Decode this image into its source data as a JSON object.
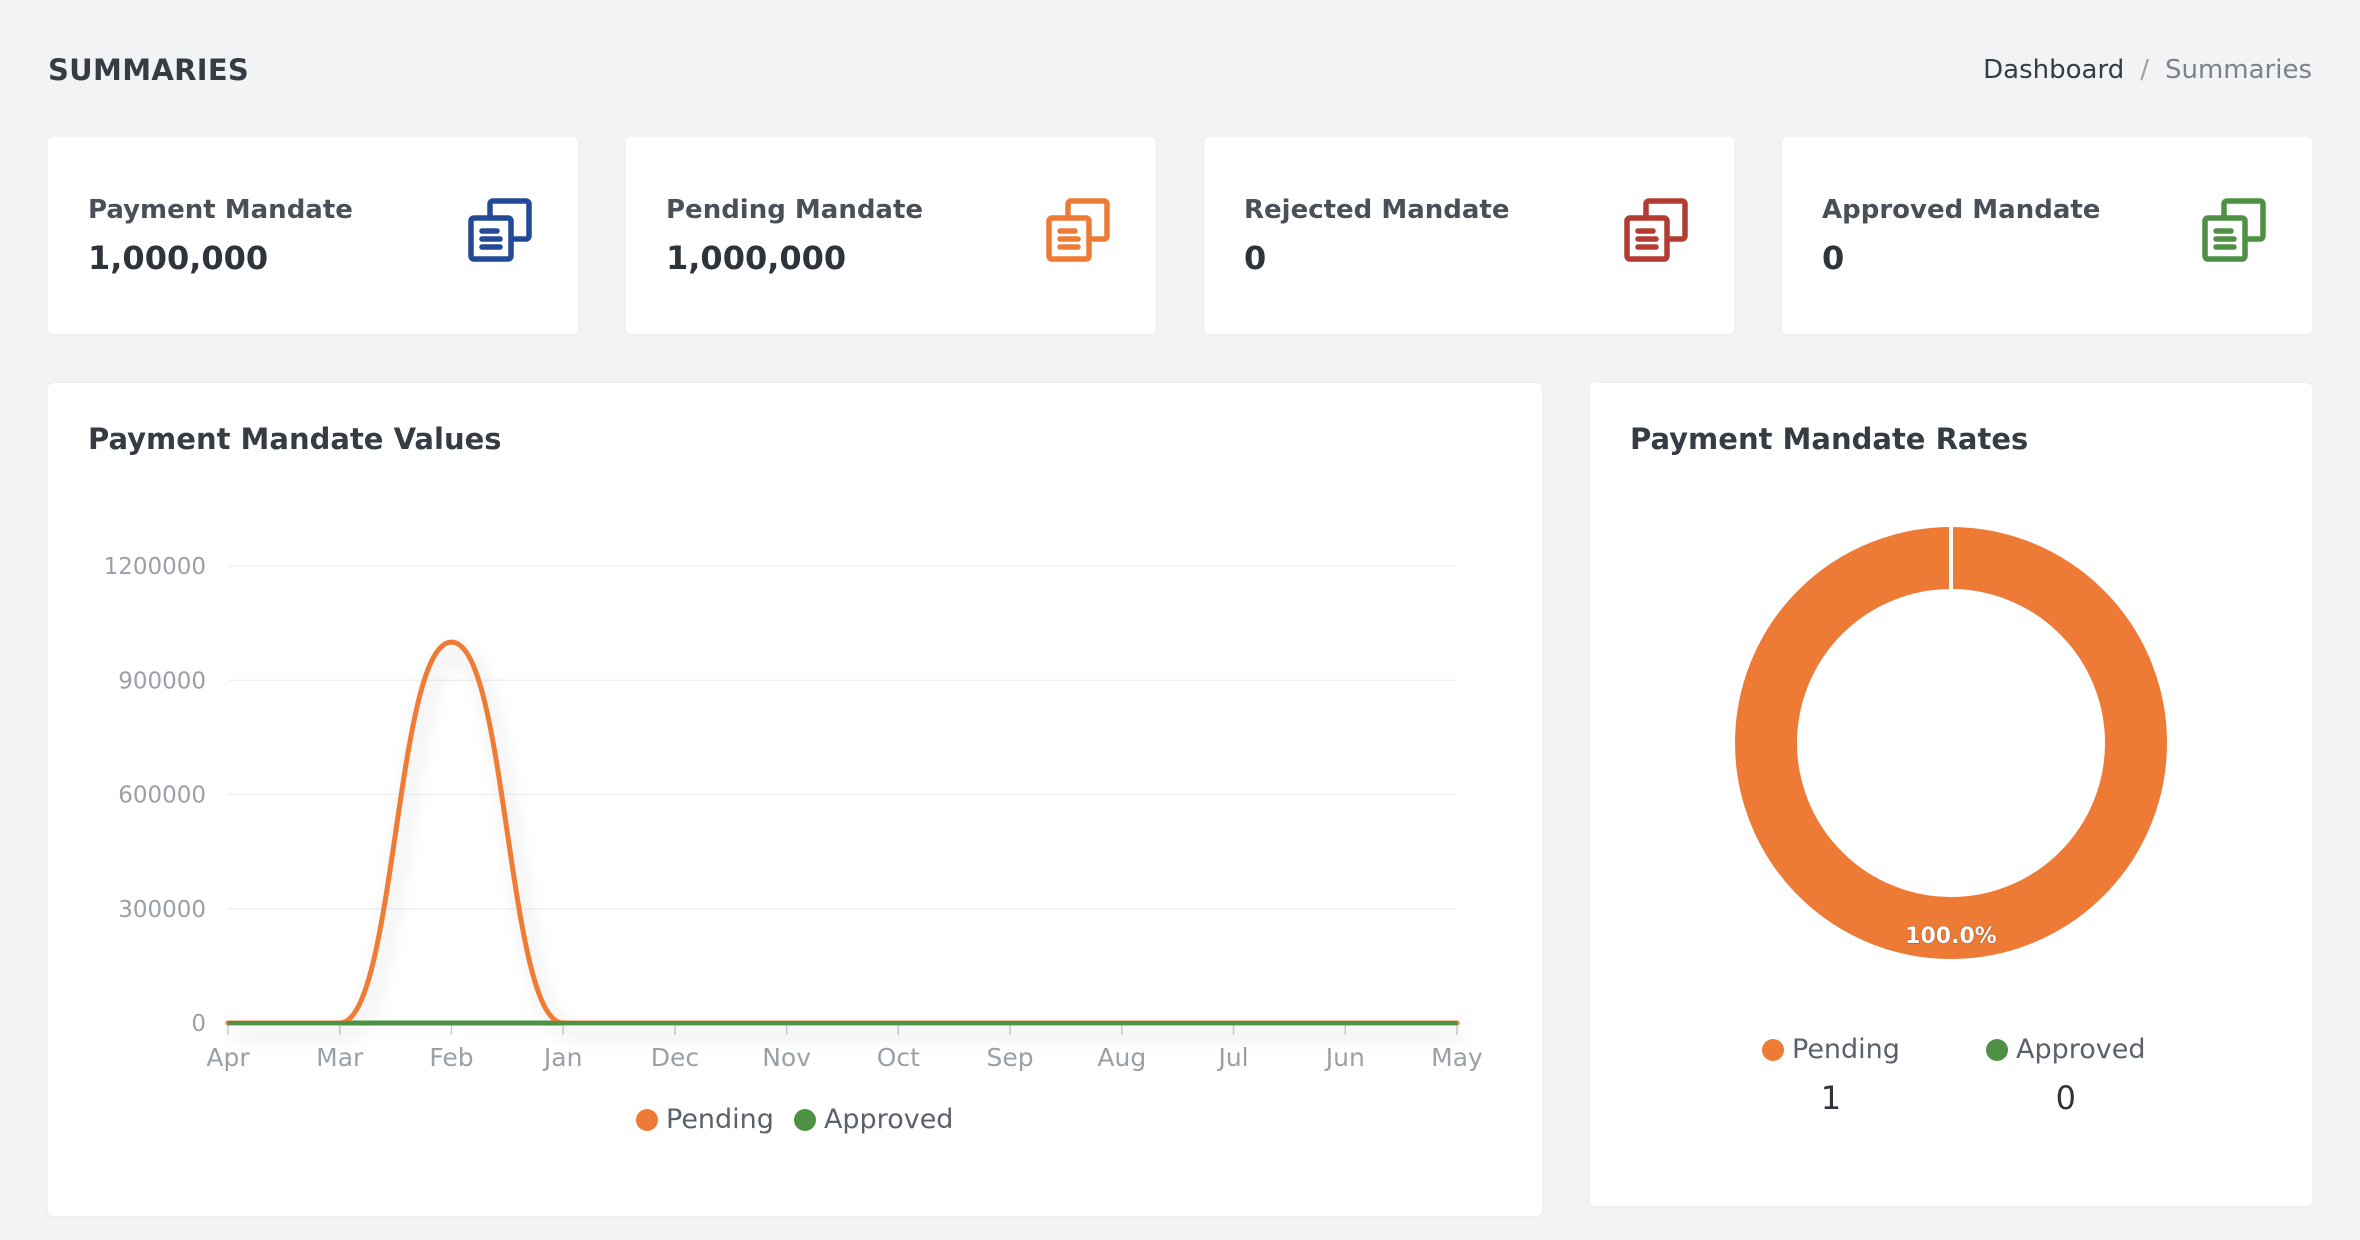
{
  "header": {
    "title": "SUMMARIES",
    "breadcrumb": {
      "home": "Dashboard",
      "separator": "/",
      "current": "Summaries"
    }
  },
  "stats": [
    {
      "label": "Payment Mandate",
      "value": "1,000,000",
      "color": "#234a96",
      "icon": "documents-icon"
    },
    {
      "label": "Pending Mandate",
      "value": "1,000,000",
      "color": "#ee7b35",
      "icon": "documents-icon"
    },
    {
      "label": "Rejected Mandate",
      "value": "0",
      "color": "#b23b32",
      "icon": "documents-icon"
    },
    {
      "label": "Approved Mandate",
      "value": "0",
      "color": "#4f9144",
      "icon": "documents-icon"
    }
  ],
  "values_panel": {
    "title": "Payment Mandate Values"
  },
  "rates_panel": {
    "title": "Payment Mandate Rates",
    "slice_label": "100.0%"
  },
  "colors": {
    "pending": "#ee7b35",
    "approved": "#4f9144",
    "grid": "#eef0f3",
    "tick": "#9aa0a8"
  },
  "chart_data": [
    {
      "type": "area",
      "title": "Payment Mandate Values",
      "categories": [
        "Apr",
        "Mar",
        "Feb",
        "Jan",
        "Dec",
        "Nov",
        "Oct",
        "Sep",
        "Aug",
        "Jul",
        "Jun",
        "May"
      ],
      "series": [
        {
          "name": "Pending",
          "color": "#ee7b35",
          "values": [
            0,
            0,
            1000000,
            0,
            0,
            0,
            0,
            0,
            0,
            0,
            0,
            0
          ]
        },
        {
          "name": "Approved",
          "color": "#4f9144",
          "values": [
            0,
            0,
            0,
            0,
            0,
            0,
            0,
            0,
            0,
            0,
            0,
            0
          ]
        }
      ],
      "yticks": [
        "0",
        "300000",
        "600000",
        "900000",
        "1200000"
      ],
      "ylim": [
        0,
        1200000
      ],
      "grid": true,
      "legend": "bottom"
    },
    {
      "type": "pie",
      "title": "Payment Mandate Rates",
      "labels": [
        "Pending",
        "Approved"
      ],
      "values": [
        1,
        0
      ],
      "value_labels": [
        "1",
        "0"
      ],
      "colors": [
        "#ee7b35",
        "#4f9144"
      ],
      "donut": true,
      "legend": "bottom"
    }
  ]
}
